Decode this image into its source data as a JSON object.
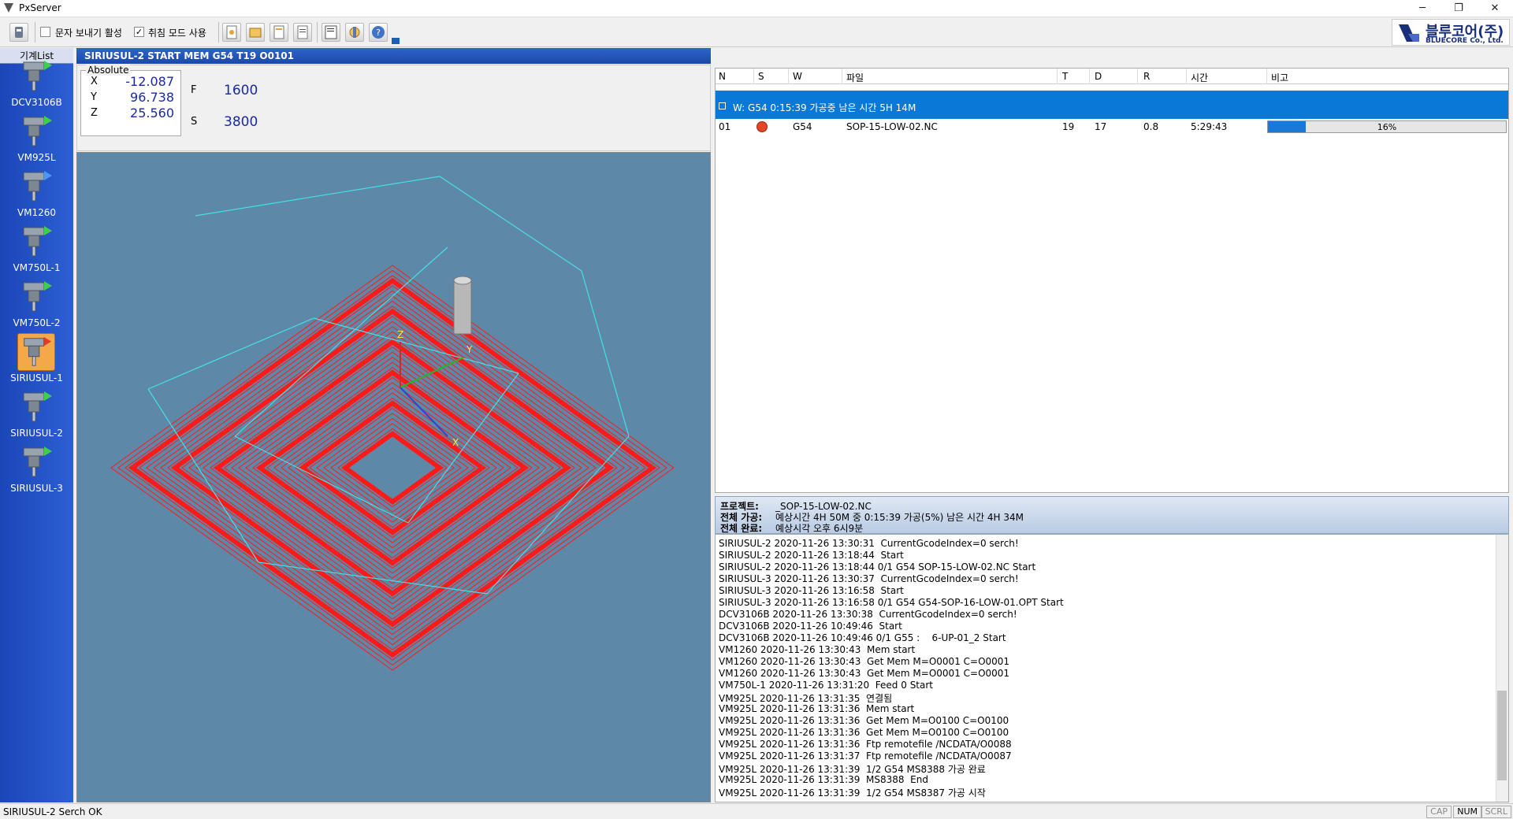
{
  "window": {
    "title": "PxServer",
    "minimize": "─",
    "restore": "❐",
    "close": "✕"
  },
  "toolbar": {
    "sms_label": "문자 보내기 활성",
    "cancel_mode_label": "취침 모드 사용",
    "sms_checked": false,
    "cancel_mode_checked": true
  },
  "logo": {
    "name": "블루코어(주)",
    "sub": "BLUECORE Co., Ltd."
  },
  "sidebar": {
    "title": "기계List",
    "machines": [
      {
        "label": "DCV3106B",
        "status": "green"
      },
      {
        "label": "VM925L",
        "status": "green"
      },
      {
        "label": "VM1260",
        "status": "blue"
      },
      {
        "label": "VM750L-1",
        "status": "green"
      },
      {
        "label": "VM750L-2",
        "status": "green"
      },
      {
        "label": "SIRIUSUL-1",
        "status": "red",
        "selected": true
      },
      {
        "label": "SIRIUSUL-2",
        "status": "green"
      },
      {
        "label": "SIRIUSUL-3",
        "status": "green"
      }
    ]
  },
  "machine_header": "SIRIUSUL-2 START  MEM     G54   T19  O0101",
  "coords": {
    "legend": "Absolute",
    "x_label": "X",
    "x": "-12.087",
    "y_label": "Y",
    "y": "96.738",
    "z_label": "Z",
    "z": "25.560",
    "f_label": "F",
    "f": "1600",
    "s_label": "S",
    "s": "3800"
  },
  "viewport": {
    "axis_x": "X",
    "axis_y": "Y",
    "axis_z": "Z"
  },
  "jobs": {
    "columns": [
      "N",
      "S",
      "W",
      "파일",
      "T",
      "D",
      "R",
      "시간",
      "비고"
    ],
    "group": "W: G54  0:15:39 가공중   남은 시간 5H 14M",
    "row": {
      "n": "01",
      "w": "G54",
      "file": "SOP-15-LOW-02.NC",
      "t": "19",
      "d": "17",
      "r": "0.8",
      "time": "5:29:43",
      "progress": 0.16,
      "progress_label": "16%"
    }
  },
  "project": {
    "k1": "프로젝트:",
    "v1": "_SOP-15-LOW-02.NC",
    "k2": "전체 가공:",
    "v2": "예상시간 4H 50M 중 0:15:39 가공(5%) 남은 시간 4H 34M",
    "k3": "전체 완료:",
    "v3": "예상시각 오후 6시9분"
  },
  "log": [
    "SIRIUSUL-2 2020-11-26 13:30:31  CurrentGcodeIndex=0 serch!",
    "SIRIUSUL-2 2020-11-26 13:18:44  Start",
    "SIRIUSUL-2 2020-11-26 13:18:44 0/1 G54 SOP-15-LOW-02.NC Start",
    "SIRIUSUL-3 2020-11-26 13:30:37  CurrentGcodeIndex=0 serch!",
    "SIRIUSUL-3 2020-11-26 13:16:58  Start",
    "SIRIUSUL-3 2020-11-26 13:16:58 0/1 G54 G54-SOP-16-LOW-01.OPT Start",
    "DCV3106B 2020-11-26 13:30:38  CurrentGcodeIndex=0 serch!",
    "DCV3106B 2020-11-26 10:49:46  Start",
    "DCV3106B 2020-11-26 10:49:46 0/1 G55 :    6-UP-01_2 Start",
    "VM1260 2020-11-26 13:30:43  Mem start",
    "VM1260 2020-11-26 13:30:43  Get Mem M=O0001 C=O0001",
    "VM1260 2020-11-26 13:30:43  Get Mem M=O0001 C=O0001",
    "VM750L-1 2020-11-26 13:31:20  Feed 0 Start",
    "VM925L 2020-11-26 13:31:35  연결됨",
    "VM925L 2020-11-26 13:31:36  Mem start",
    "VM925L 2020-11-26 13:31:36  Get Mem M=O0100 C=O0100",
    "VM925L 2020-11-26 13:31:36  Get Mem M=O0100 C=O0100",
    "VM925L 2020-11-26 13:31:36  Ftp remotefile /NCDATA/O0088",
    "VM925L 2020-11-26 13:31:37  Ftp remotefile /NCDATA/O0087",
    "VM925L 2020-11-26 13:31:39  1/2 G54 MS8388 가공 완료",
    "VM925L 2020-11-26 13:31:39  MS8388  End",
    "VM925L 2020-11-26 13:31:39  1/2 G54 MS8387 가공 시작"
  ],
  "status": {
    "message": "SIRIUSUL-2 Serch OK",
    "cap": "CAP",
    "num": "NUM",
    "scrl": "SCRL"
  },
  "colors": {
    "accent": "#1a78d6",
    "sidebar": "#2350c4",
    "viewport_bg": "#5d88a7",
    "toolpath": "#ff1a1a",
    "rapid": "#45e0e8"
  }
}
